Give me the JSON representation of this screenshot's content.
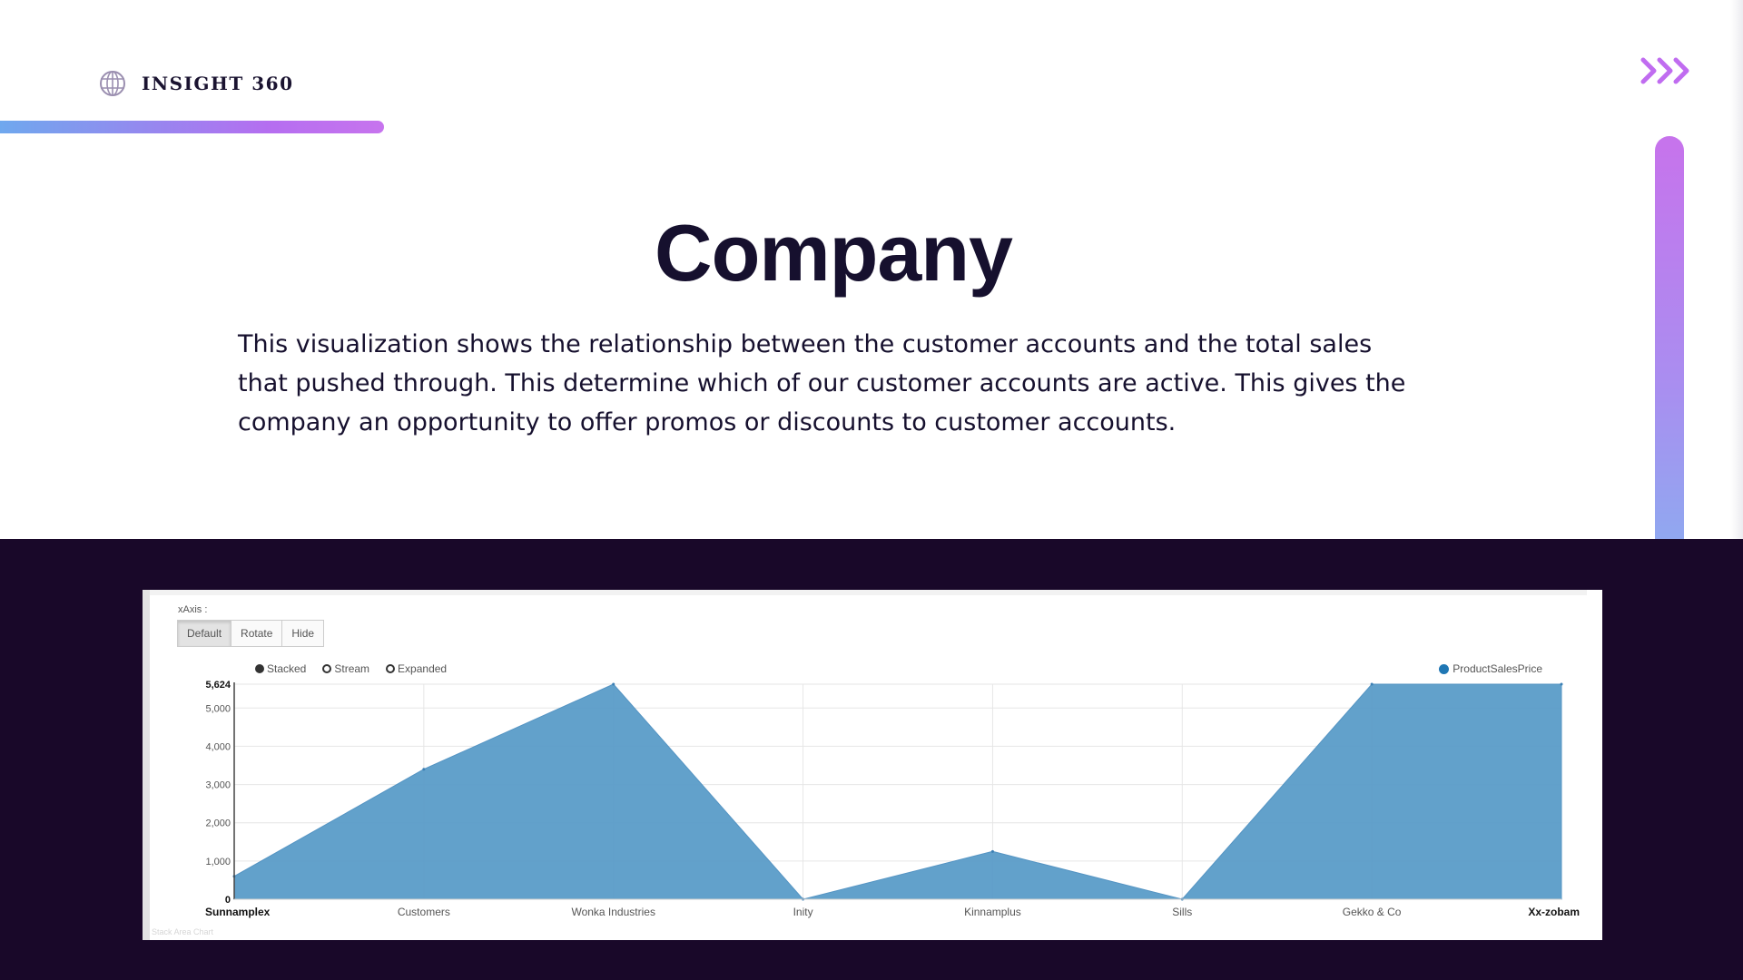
{
  "brand": {
    "name": "INSIGHT 360",
    "icon": "globe-icon",
    "accent": "#b56ef0"
  },
  "nav": {
    "next_icon": "triple-chevron-right-icon",
    "color": "#c06cf0"
  },
  "page": {
    "title": "Company",
    "description": "This visualization shows the relationship between the customer accounts and the total sales that pushed through. This determine which of our customer accounts are active. This gives the company an opportunity to offer promos or discounts to customer accounts."
  },
  "controls": {
    "xaxis_label": "xAxis :",
    "buttons": [
      "Default",
      "Rotate",
      "Hide"
    ],
    "active_button": "Default",
    "modes": [
      "Stacked",
      "Stream",
      "Expanded"
    ],
    "active_mode": "Stacked",
    "footer_note": "Stack Area Chart"
  },
  "chart_data": {
    "type": "area",
    "categories": [
      "Sunnamplex",
      "Customers",
      "Wonka Industries",
      "Inity",
      "Kinnamplus",
      "Sills",
      "Gekko & Co",
      "Xx-zobam"
    ],
    "series": [
      {
        "name": "ProductSalesPrice",
        "values": [
          600,
          3400,
          5624,
          0,
          1250,
          0,
          5624,
          5624
        ],
        "color": "#1f77b4"
      }
    ],
    "yticks": [
      0,
      1000,
      2000,
      3000,
      4000,
      5000,
      5624
    ],
    "ytick_labels": [
      "0",
      "1,000",
      "2,000",
      "3,000",
      "4,000",
      "5,000",
      "5,624"
    ],
    "ylim": [
      0,
      5624
    ],
    "grid": true,
    "legend": "top-right",
    "xlabel": "",
    "ylabel": ""
  },
  "colors": {
    "background": "#ffffff",
    "dark_band": "#190829",
    "title": "#16102e",
    "area_fill": "#5a9cc9"
  }
}
